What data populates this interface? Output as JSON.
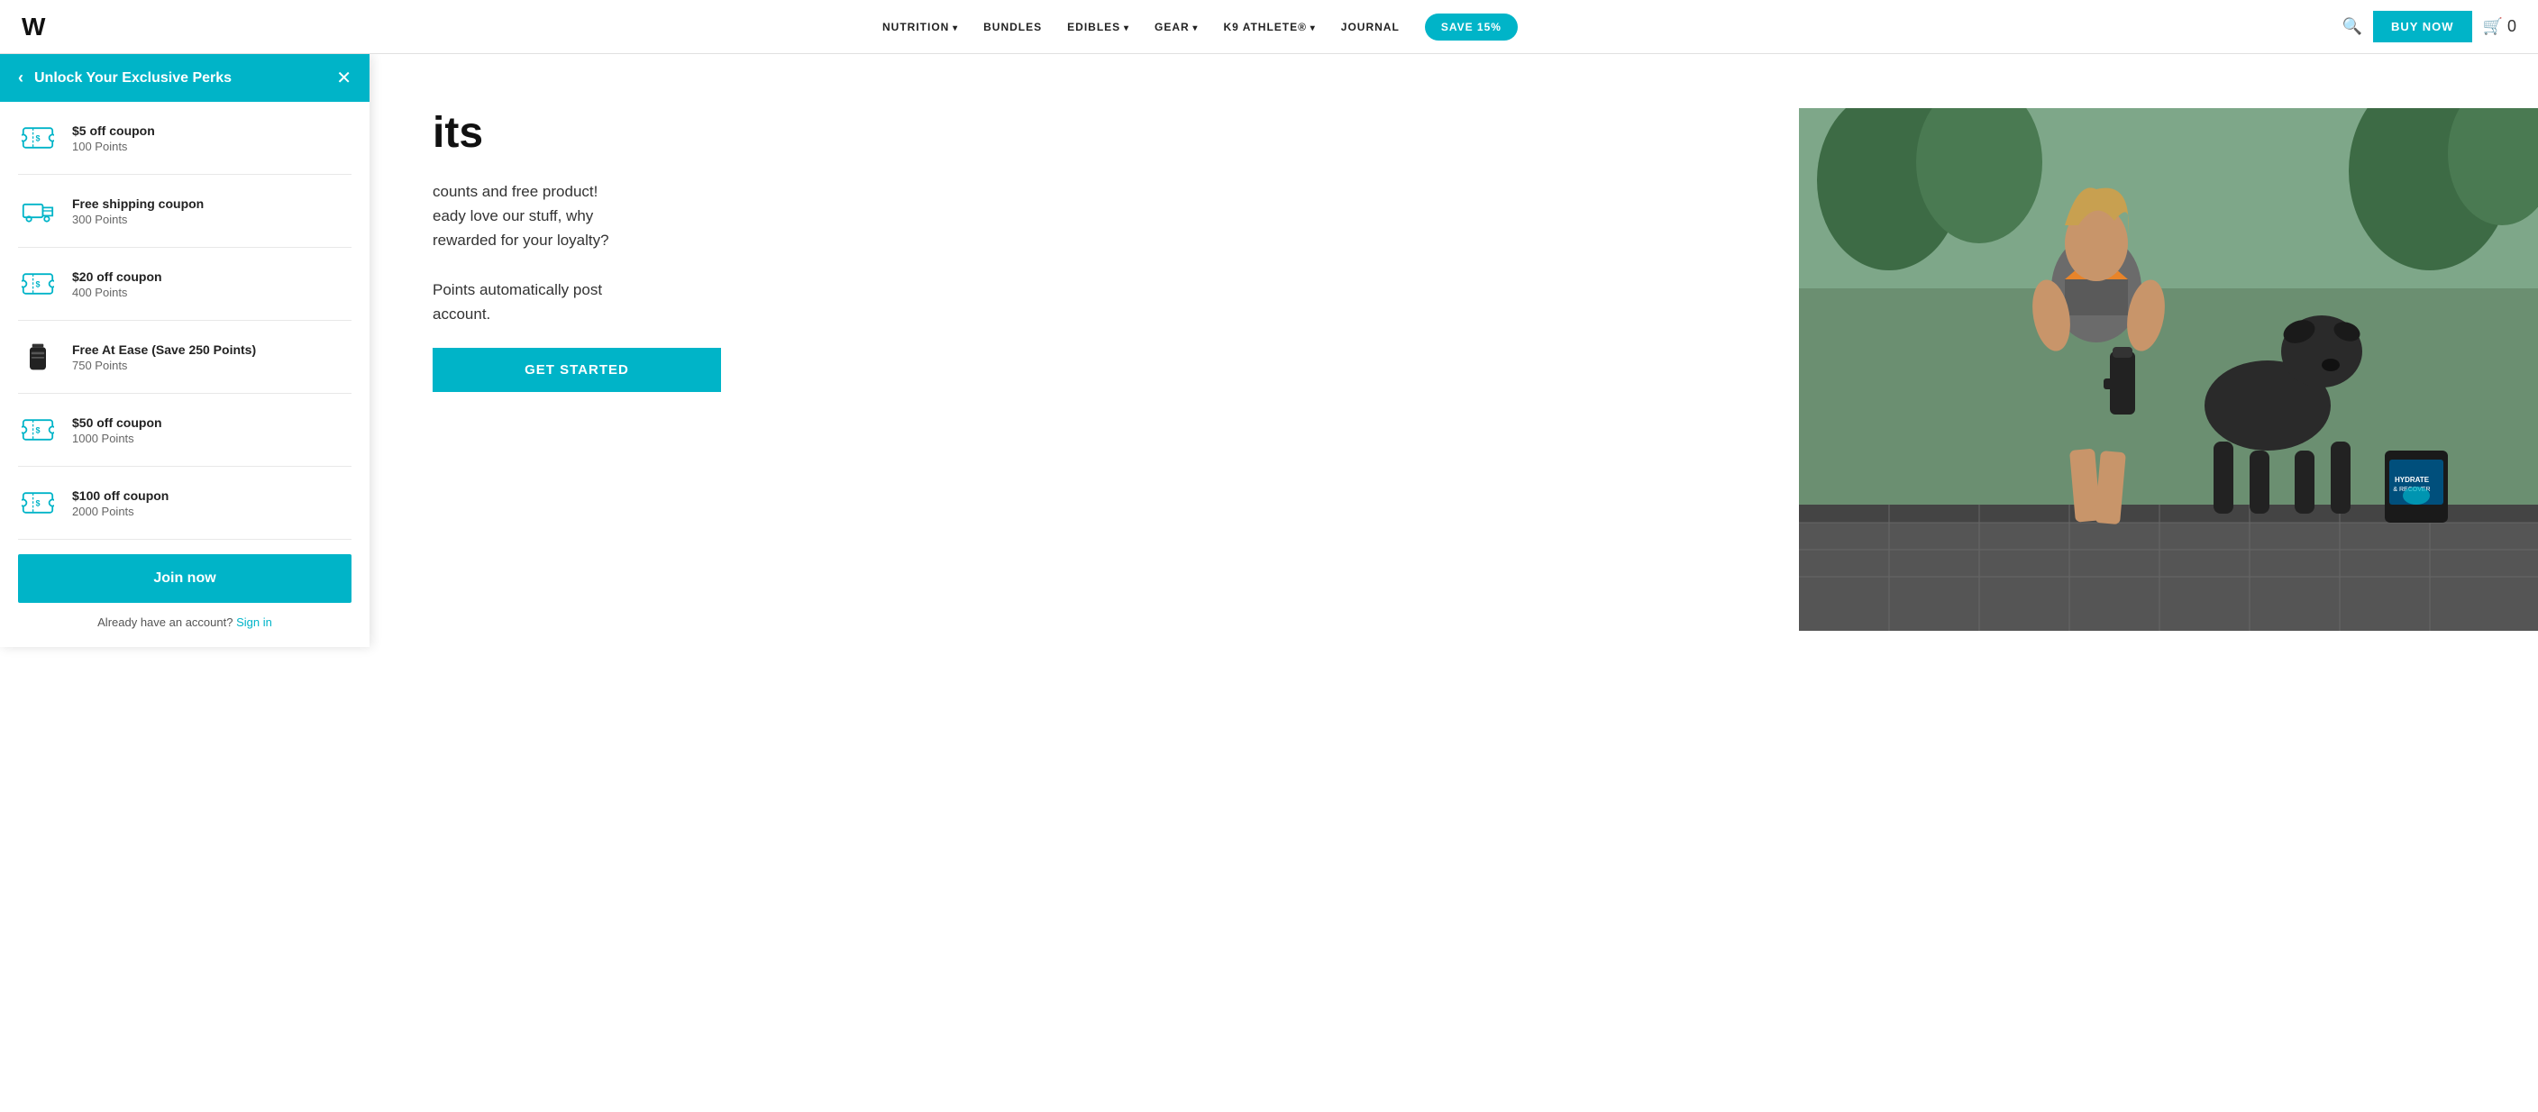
{
  "nav": {
    "logo": "W",
    "links": [
      {
        "label": "NUTRITION",
        "hasArrow": true
      },
      {
        "label": "BUNDLES",
        "hasArrow": false
      },
      {
        "label": "EDIBLES",
        "hasArrow": true
      },
      {
        "label": "GEAR",
        "hasArrow": true
      },
      {
        "label": "K9 ATHLETE®",
        "hasArrow": true
      },
      {
        "label": "JOURNAL",
        "hasArrow": false
      }
    ],
    "save_btn": "SAVE 15%",
    "buy_btn": "BUY NOW",
    "cart_count": "0"
  },
  "panel": {
    "title": "Unlock Your Exclusive Perks",
    "back_label": "‹",
    "close_label": "✕",
    "rewards": [
      {
        "name": "$5 off coupon",
        "points": "100 Points",
        "icon": "coupon"
      },
      {
        "name": "Free shipping coupon",
        "points": "300 Points",
        "icon": "shipping"
      },
      {
        "name": "$20 off coupon",
        "points": "400 Points",
        "icon": "coupon"
      },
      {
        "name": "Free At Ease (Save 250 Points)",
        "points": "750 Points",
        "icon": "bottle"
      },
      {
        "name": "$50 off coupon",
        "points": "1000 Points",
        "icon": "coupon"
      },
      {
        "name": "$100 off coupon",
        "points": "2000 Points",
        "icon": "coupon"
      }
    ],
    "join_btn": "Join now",
    "already_text": "Already have an account?",
    "sign_in": "Sign in"
  },
  "page": {
    "heading": "its",
    "body_line1": "counts and free product!",
    "body_line2": "eady love our stuff, why",
    "body_line3": "rewarded for your loyalty?",
    "body_line4": "",
    "body_line5": "Points automatically post",
    "body_line6": "account.",
    "get_started_btn": "GET STARTED"
  }
}
